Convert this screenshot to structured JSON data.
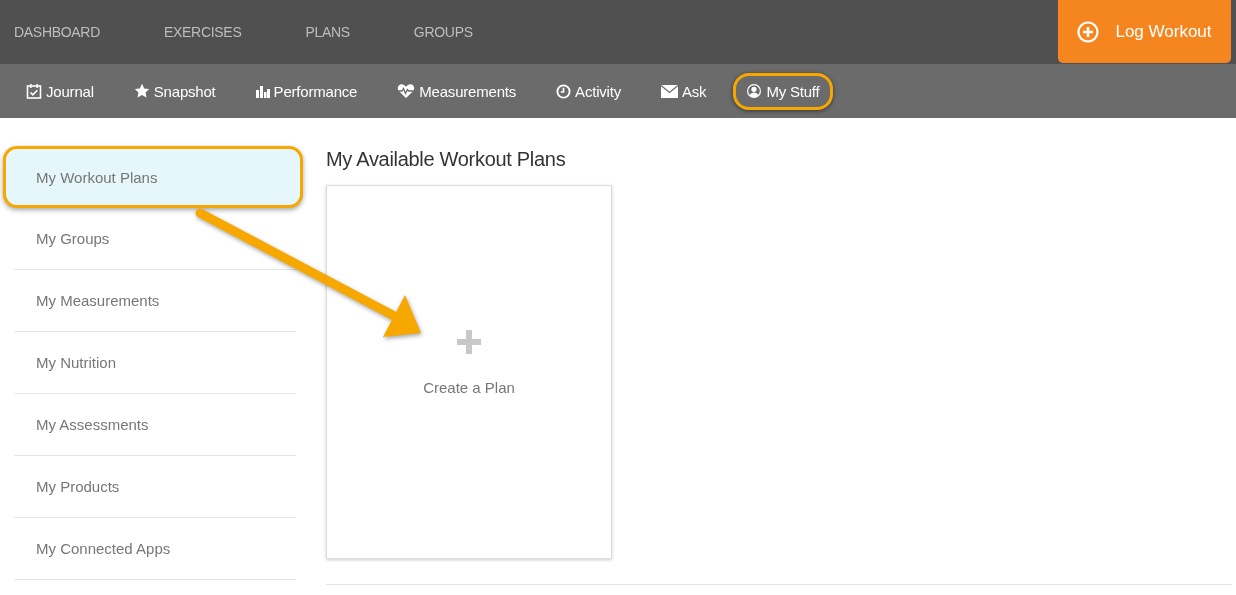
{
  "top_nav": [
    {
      "label": "DASHBOARD"
    },
    {
      "label": "EXERCISES"
    },
    {
      "label": "PLANS"
    },
    {
      "label": "GROUPS"
    }
  ],
  "log_button": {
    "label": "Log Workout"
  },
  "sub_nav": [
    {
      "label": "Journal",
      "highlighted": false
    },
    {
      "label": "Snapshot",
      "highlighted": false
    },
    {
      "label": "Performance",
      "highlighted": false
    },
    {
      "label": "Measurements",
      "highlighted": false
    },
    {
      "label": "Activity",
      "highlighted": false
    },
    {
      "label": "Ask",
      "highlighted": false
    },
    {
      "label": "My Stuff",
      "highlighted": true
    }
  ],
  "sidebar": {
    "items": [
      {
        "label": "My Workout Plans",
        "selected": true,
        "highlighted": true
      },
      {
        "label": "My Groups",
        "selected": false,
        "highlighted": false
      },
      {
        "label": "My Measurements",
        "selected": false,
        "highlighted": false
      },
      {
        "label": "My Nutrition",
        "selected": false,
        "highlighted": false
      },
      {
        "label": "My Assessments",
        "selected": false,
        "highlighted": false
      },
      {
        "label": "My Products",
        "selected": false,
        "highlighted": false
      },
      {
        "label": "My Connected Apps",
        "selected": false,
        "highlighted": false
      }
    ]
  },
  "main": {
    "title": "My Available Workout Plans",
    "create_card": {
      "label": "Create a Plan"
    }
  }
}
